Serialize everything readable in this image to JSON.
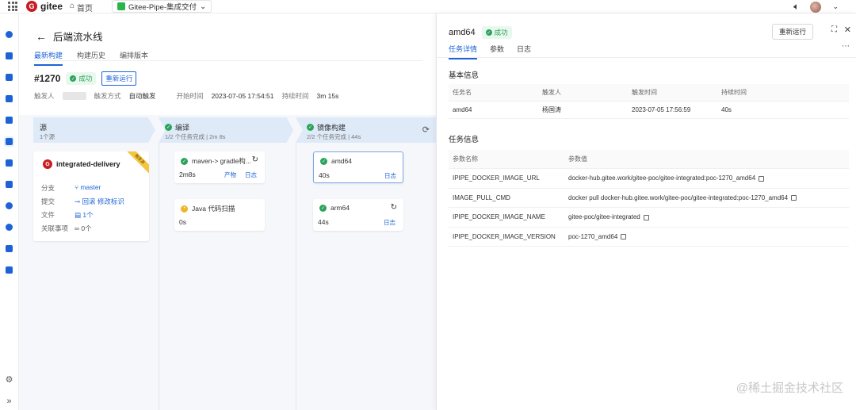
{
  "topbar": {
    "brand": "gitee",
    "home": "首页",
    "project": "Gitee-Pipe-集成交付"
  },
  "left": {
    "title": "后端流水线",
    "tabs": [
      "最新构建",
      "构建历史",
      "编排版本"
    ],
    "run": {
      "number": "#1270",
      "status": "成功",
      "rerun": "重新运行",
      "trigger_label": "触发人",
      "trigger_mode_label": "触发方式",
      "trigger_mode": "自动触发",
      "start_label": "开始时间",
      "start_time": "2023-07-05 17:54:51",
      "duration_label": "持续时间",
      "duration": "3m 15s"
    },
    "stages": [
      {
        "title": "源",
        "sub": "1个源"
      },
      {
        "title": "编译",
        "sub": "1/2 个任务完成 | 2m 8s"
      },
      {
        "title": "镜像构建",
        "sub": "2/2 个任务完成 | 44s"
      }
    ],
    "source": {
      "name": "integrated-delivery",
      "ribbon": "触发源",
      "branch_label": "分支",
      "branch": "master",
      "commit_label": "提交",
      "commit": "回滚 修改标识",
      "files_label": "文件",
      "files": "1个",
      "related_label": "关联事项",
      "related": "0个"
    },
    "jobs": {
      "maven": {
        "name": "maven-> gradle构...",
        "time": "2m8s",
        "artifact": "产物",
        "log": "日志"
      },
      "java": {
        "name": "Java 代码扫描",
        "time": "0s"
      },
      "amd64": {
        "name": "amd64",
        "time": "40s",
        "log": "日志"
      },
      "arm64": {
        "name": "arm64",
        "time": "44s",
        "log": "日志"
      }
    }
  },
  "right": {
    "title": "amd64",
    "status": "成功",
    "rerun": "重新运行",
    "tabs": [
      "任务详情",
      "参数",
      "日志"
    ],
    "basic_title": "基本信息",
    "basic_headers": [
      "任务名",
      "触发人",
      "触发时间",
      "持续时间"
    ],
    "basic_row": [
      "amd64",
      "杨国涛",
      "2023-07-05 17:56:59",
      "40s"
    ],
    "task_title": "任务信息",
    "param_headers": [
      "参数名称",
      "参数值"
    ],
    "params": [
      {
        "k": "IPIPE_DOCKER_IMAGE_URL",
        "v": "docker-hub.gitee.work/gitee-poc/gitee-integrated:poc-1270_amd64"
      },
      {
        "k": "IMAGE_PULL_CMD",
        "v": "docker pull docker-hub.gitee.work/gitee-poc/gitee-integrated:poc-1270_amd64"
      },
      {
        "k": "IPIPE_DOCKER_IMAGE_NAME",
        "v": "gitee-poc/gitee-integrated"
      },
      {
        "k": "IPIPE_DOCKER_IMAGE_VERSION",
        "v": "poc-1270_amd64"
      }
    ]
  },
  "watermark": "@稀土掘金技术社区",
  "colors": {
    "accent": "#1e63d6",
    "success": "#2ba45a",
    "warning": "#f0b429",
    "brand": "#c71d23"
  }
}
